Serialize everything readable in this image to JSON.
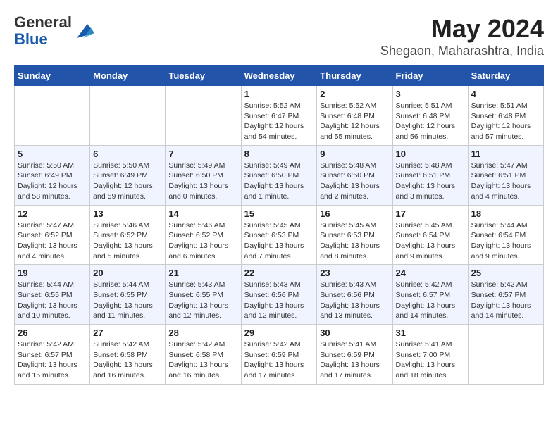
{
  "header": {
    "logo_line1": "General",
    "logo_line2": "Blue",
    "month": "May 2024",
    "location": "Shegaon, Maharashtra, India"
  },
  "weekdays": [
    "Sunday",
    "Monday",
    "Tuesday",
    "Wednesday",
    "Thursday",
    "Friday",
    "Saturday"
  ],
  "weeks": [
    [
      {
        "day": "",
        "detail": ""
      },
      {
        "day": "",
        "detail": ""
      },
      {
        "day": "",
        "detail": ""
      },
      {
        "day": "1",
        "detail": "Sunrise: 5:52 AM\nSunset: 6:47 PM\nDaylight: 12 hours\nand 54 minutes."
      },
      {
        "day": "2",
        "detail": "Sunrise: 5:52 AM\nSunset: 6:48 PM\nDaylight: 12 hours\nand 55 minutes."
      },
      {
        "day": "3",
        "detail": "Sunrise: 5:51 AM\nSunset: 6:48 PM\nDaylight: 12 hours\nand 56 minutes."
      },
      {
        "day": "4",
        "detail": "Sunrise: 5:51 AM\nSunset: 6:48 PM\nDaylight: 12 hours\nand 57 minutes."
      }
    ],
    [
      {
        "day": "5",
        "detail": "Sunrise: 5:50 AM\nSunset: 6:49 PM\nDaylight: 12 hours\nand 58 minutes."
      },
      {
        "day": "6",
        "detail": "Sunrise: 5:50 AM\nSunset: 6:49 PM\nDaylight: 12 hours\nand 59 minutes."
      },
      {
        "day": "7",
        "detail": "Sunrise: 5:49 AM\nSunset: 6:50 PM\nDaylight: 13 hours\nand 0 minutes."
      },
      {
        "day": "8",
        "detail": "Sunrise: 5:49 AM\nSunset: 6:50 PM\nDaylight: 13 hours\nand 1 minute."
      },
      {
        "day": "9",
        "detail": "Sunrise: 5:48 AM\nSunset: 6:50 PM\nDaylight: 13 hours\nand 2 minutes."
      },
      {
        "day": "10",
        "detail": "Sunrise: 5:48 AM\nSunset: 6:51 PM\nDaylight: 13 hours\nand 3 minutes."
      },
      {
        "day": "11",
        "detail": "Sunrise: 5:47 AM\nSunset: 6:51 PM\nDaylight: 13 hours\nand 4 minutes."
      }
    ],
    [
      {
        "day": "12",
        "detail": "Sunrise: 5:47 AM\nSunset: 6:52 PM\nDaylight: 13 hours\nand 4 minutes."
      },
      {
        "day": "13",
        "detail": "Sunrise: 5:46 AM\nSunset: 6:52 PM\nDaylight: 13 hours\nand 5 minutes."
      },
      {
        "day": "14",
        "detail": "Sunrise: 5:46 AM\nSunset: 6:52 PM\nDaylight: 13 hours\nand 6 minutes."
      },
      {
        "day": "15",
        "detail": "Sunrise: 5:45 AM\nSunset: 6:53 PM\nDaylight: 13 hours\nand 7 minutes."
      },
      {
        "day": "16",
        "detail": "Sunrise: 5:45 AM\nSunset: 6:53 PM\nDaylight: 13 hours\nand 8 minutes."
      },
      {
        "day": "17",
        "detail": "Sunrise: 5:45 AM\nSunset: 6:54 PM\nDaylight: 13 hours\nand 9 minutes."
      },
      {
        "day": "18",
        "detail": "Sunrise: 5:44 AM\nSunset: 6:54 PM\nDaylight: 13 hours\nand 9 minutes."
      }
    ],
    [
      {
        "day": "19",
        "detail": "Sunrise: 5:44 AM\nSunset: 6:55 PM\nDaylight: 13 hours\nand 10 minutes."
      },
      {
        "day": "20",
        "detail": "Sunrise: 5:44 AM\nSunset: 6:55 PM\nDaylight: 13 hours\nand 11 minutes."
      },
      {
        "day": "21",
        "detail": "Sunrise: 5:43 AM\nSunset: 6:55 PM\nDaylight: 13 hours\nand 12 minutes."
      },
      {
        "day": "22",
        "detail": "Sunrise: 5:43 AM\nSunset: 6:56 PM\nDaylight: 13 hours\nand 12 minutes."
      },
      {
        "day": "23",
        "detail": "Sunrise: 5:43 AM\nSunset: 6:56 PM\nDaylight: 13 hours\nand 13 minutes."
      },
      {
        "day": "24",
        "detail": "Sunrise: 5:42 AM\nSunset: 6:57 PM\nDaylight: 13 hours\nand 14 minutes."
      },
      {
        "day": "25",
        "detail": "Sunrise: 5:42 AM\nSunset: 6:57 PM\nDaylight: 13 hours\nand 14 minutes."
      }
    ],
    [
      {
        "day": "26",
        "detail": "Sunrise: 5:42 AM\nSunset: 6:57 PM\nDaylight: 13 hours\nand 15 minutes."
      },
      {
        "day": "27",
        "detail": "Sunrise: 5:42 AM\nSunset: 6:58 PM\nDaylight: 13 hours\nand 16 minutes."
      },
      {
        "day": "28",
        "detail": "Sunrise: 5:42 AM\nSunset: 6:58 PM\nDaylight: 13 hours\nand 16 minutes."
      },
      {
        "day": "29",
        "detail": "Sunrise: 5:42 AM\nSunset: 6:59 PM\nDaylight: 13 hours\nand 17 minutes."
      },
      {
        "day": "30",
        "detail": "Sunrise: 5:41 AM\nSunset: 6:59 PM\nDaylight: 13 hours\nand 17 minutes."
      },
      {
        "day": "31",
        "detail": "Sunrise: 5:41 AM\nSunset: 7:00 PM\nDaylight: 13 hours\nand 18 minutes."
      },
      {
        "day": "",
        "detail": ""
      }
    ]
  ]
}
